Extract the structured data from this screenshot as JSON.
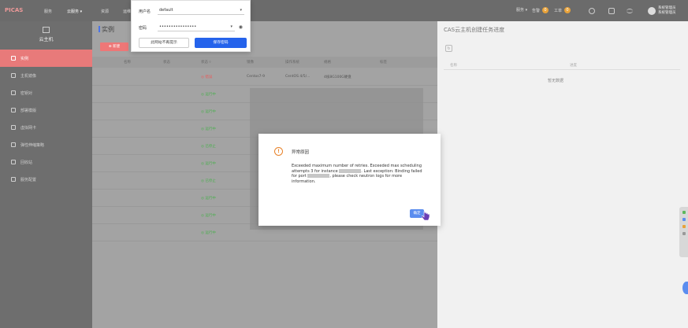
{
  "topbar": {
    "logo": "PICAS",
    "nav": [
      "服务",
      "云服务 ▾",
      "资源",
      "运维"
    ],
    "right_label_1": "服务 ▾",
    "right_label_2": "告警",
    "right_badge_2": "0",
    "right_label_3": "工单",
    "right_badge_3": "0",
    "user_line1": "系统管理员",
    "user_line2": "系统管理员"
  },
  "sidebar": {
    "header": "云主机",
    "items": [
      {
        "label": "实例",
        "active": true
      },
      {
        "label": "主机镜像"
      },
      {
        "label": "密钥对"
      },
      {
        "label": "部署模版"
      },
      {
        "label": "虚拟网卡"
      },
      {
        "label": "弹性伸缩策略"
      },
      {
        "label": "回收站"
      },
      {
        "label": "服务配置"
      }
    ]
  },
  "main": {
    "title": "实例",
    "add_button": "⊕ 新建",
    "columns": [
      "名称",
      "状态",
      "状态 ▿",
      "镜像",
      "操作系统",
      "规格",
      "标签"
    ],
    "rows": [
      {
        "status": "◎ 错误",
        "status_type": "error",
        "image": "Centos7-9",
        "os": "CentOS 4/5/...",
        "spec": "4核8G100G硬盘"
      },
      {
        "status": "◎ 运行中",
        "status_type": "ok"
      },
      {
        "status": "◎ 运行中",
        "status_type": "ok"
      },
      {
        "status": "◎ 运行中",
        "status_type": "ok"
      },
      {
        "status": "◎ 已停止",
        "status_type": "ok"
      },
      {
        "status": "◎ 运行中",
        "status_type": "ok"
      },
      {
        "status": "◎ 已停止",
        "status_type": "ok"
      },
      {
        "status": "◎ 运行中",
        "status_type": "ok"
      },
      {
        "status": "◎ 运行中",
        "status_type": "ok"
      },
      {
        "status": "◎ 运行中",
        "status_type": "ok"
      }
    ]
  },
  "right_panel": {
    "title": "CAS云主机创建任务进度",
    "col1": "名称",
    "col2": "进度",
    "empty": "暂无数据"
  },
  "login_popup": {
    "username_label": "用户名",
    "username_value": "default",
    "password_label": "密码",
    "password_value": "••••••••••••••••",
    "never_button": "此网站不再提示",
    "save_button": "保存密码"
  },
  "dialog": {
    "title": "异常原因",
    "msg_part1": "Exceeded maximum number of retries. Exceeded max scheduling attempts 3 for instance",
    "msg_part2": ". Last exception: Binding failed for port",
    "msg_part3": ", please check neutron logs for more information.",
    "ok": "确定"
  }
}
